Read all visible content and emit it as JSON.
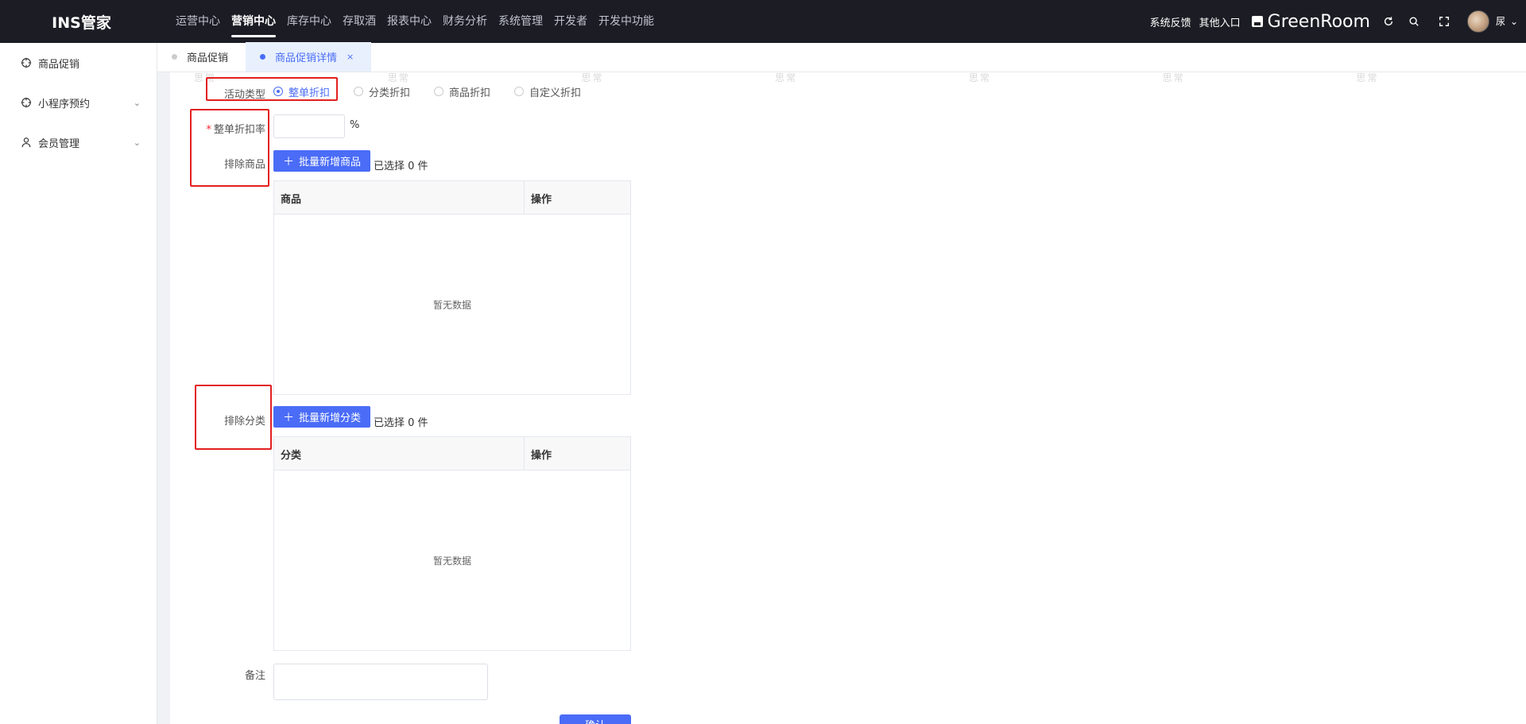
{
  "header": {
    "brand": "INS管家",
    "nav": [
      {
        "label": "运营中心",
        "active": false
      },
      {
        "label": "营销中心",
        "active": true
      },
      {
        "label": "库存中心",
        "active": false
      },
      {
        "label": "存取酒",
        "active": false
      },
      {
        "label": "报表中心",
        "active": false
      },
      {
        "label": "财务分析",
        "active": false
      },
      {
        "label": "系统管理",
        "active": false
      },
      {
        "label": "开发者",
        "active": false
      },
      {
        "label": "开发中功能",
        "active": false
      }
    ],
    "feedback": "系统反馈",
    "other_entry": "其他入口",
    "store_name": "GreenRoom",
    "user_name": "尿",
    "icons": [
      "refresh-icon",
      "search-icon",
      "fullscreen-icon",
      "chevron-down-icon"
    ]
  },
  "sidebar": {
    "items": [
      {
        "label": "商品促销",
        "icon": "target-icon",
        "expandable": false
      },
      {
        "label": "小程序预约",
        "icon": "target-icon",
        "expandable": true
      },
      {
        "label": "会员管理",
        "icon": "user-icon",
        "expandable": true
      }
    ]
  },
  "tabs": [
    {
      "label": "商品促销",
      "active": false,
      "closable": false
    },
    {
      "label": "商品促销详情",
      "active": true,
      "closable": true,
      "close_glyph": "×"
    }
  ],
  "watermark": "思常",
  "form": {
    "activity_type": {
      "label": "活动类型",
      "options": [
        {
          "label": "整单折扣",
          "checked": true
        },
        {
          "label": "分类折扣",
          "checked": false
        },
        {
          "label": "商品折扣",
          "checked": false
        },
        {
          "label": "自定义折扣",
          "checked": false
        }
      ]
    },
    "discount_rate": {
      "label": "整单折扣率",
      "required_mark": "*",
      "value": "",
      "unit": "%"
    },
    "exclude_products": {
      "label": "排除商品",
      "button": "批量新增商品",
      "button_icon": "＋",
      "selected": "已选择 0 件",
      "table": {
        "columns": [
          "商品",
          "操作"
        ],
        "empty": "暂无数据"
      }
    },
    "exclude_categories": {
      "label": "排除分类",
      "button": "批量新增分类",
      "button_icon": "＋",
      "selected": "已选择 0 件",
      "table": {
        "columns": [
          "分类",
          "操作"
        ],
        "empty": "暂无数据"
      }
    },
    "remark": {
      "label": "备注",
      "value": ""
    },
    "submit": "确认"
  },
  "colors": {
    "primary": "#4a6cf7",
    "topbar": "#1c1c24",
    "highlight": "#e32020"
  }
}
